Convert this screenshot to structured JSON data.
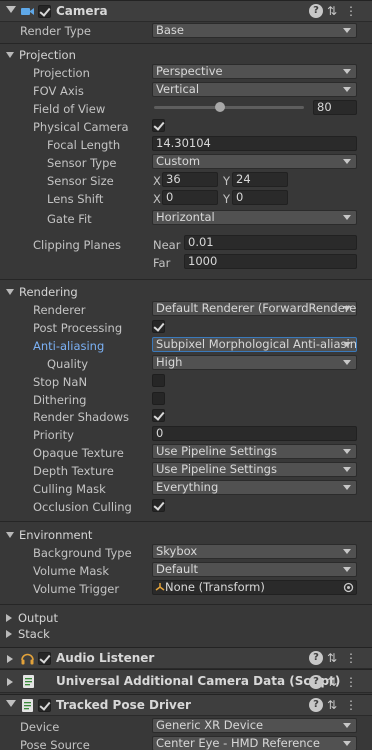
{
  "camera": {
    "title": "Camera",
    "render_type": {
      "label": "Render Type",
      "value": "Base"
    },
    "projection": {
      "header": "Projection",
      "projection": {
        "label": "Projection",
        "value": "Perspective"
      },
      "fov_axis": {
        "label": "FOV Axis",
        "value": "Vertical"
      },
      "field_of_view": {
        "label": "Field of View",
        "value": "80",
        "fraction": 0.44
      },
      "physical_camera": {
        "label": "Physical Camera",
        "checked": true
      },
      "focal_length": {
        "label": "Focal Length",
        "value": "14.30104"
      },
      "sensor_type": {
        "label": "Sensor Type",
        "value": "Custom"
      },
      "sensor_size": {
        "label": "Sensor Size",
        "x_label": "X",
        "x": "36",
        "y_label": "Y",
        "y": "24"
      },
      "lens_shift": {
        "label": "Lens Shift",
        "x_label": "X",
        "x": "0",
        "y_label": "Y",
        "y": "0"
      },
      "gate_fit": {
        "label": "Gate Fit",
        "value": "Horizontal"
      },
      "clipping_planes": {
        "label": "Clipping Planes",
        "near_label": "Near",
        "near": "0.01",
        "far_label": "Far",
        "far": "1000"
      }
    },
    "rendering": {
      "header": "Rendering",
      "renderer": {
        "label": "Renderer",
        "value": "Default Renderer (ForwardRenderer)"
      },
      "post_processing": {
        "label": "Post Processing",
        "checked": true
      },
      "anti_aliasing": {
        "label": "Anti-aliasing",
        "value": "Subpixel Morphological Anti-aliasing"
      },
      "quality": {
        "label": "Quality",
        "value": "High"
      },
      "stop_nan": {
        "label": "Stop NaN",
        "checked": false
      },
      "dithering": {
        "label": "Dithering",
        "checked": false
      },
      "render_shadows": {
        "label": "Render Shadows",
        "checked": true
      },
      "priority": {
        "label": "Priority",
        "value": "0"
      },
      "opaque_texture": {
        "label": "Opaque Texture",
        "value": "Use Pipeline Settings"
      },
      "depth_texture": {
        "label": "Depth Texture",
        "value": "Use Pipeline Settings"
      },
      "culling_mask": {
        "label": "Culling Mask",
        "value": "Everything"
      },
      "occlusion_culling": {
        "label": "Occlusion Culling",
        "checked": true
      }
    },
    "environment": {
      "header": "Environment",
      "background_type": {
        "label": "Background Type",
        "value": "Skybox"
      },
      "volume_mask": {
        "label": "Volume Mask",
        "value": "Default"
      },
      "volume_trigger": {
        "label": "Volume Trigger",
        "value": "None (Transform)"
      }
    },
    "output": {
      "header": "Output"
    },
    "stack": {
      "header": "Stack"
    }
  },
  "audio_listener": {
    "title": "Audio Listener"
  },
  "additional_camera_data": {
    "title": "Universal Additional Camera Data (Script)"
  },
  "tracked_pose_driver": {
    "title": "Tracked Pose Driver",
    "device": {
      "label": "Device",
      "value": "Generic XR Device"
    },
    "pose_source": {
      "label": "Pose Source",
      "value": "Center Eye - HMD Reference"
    }
  }
}
